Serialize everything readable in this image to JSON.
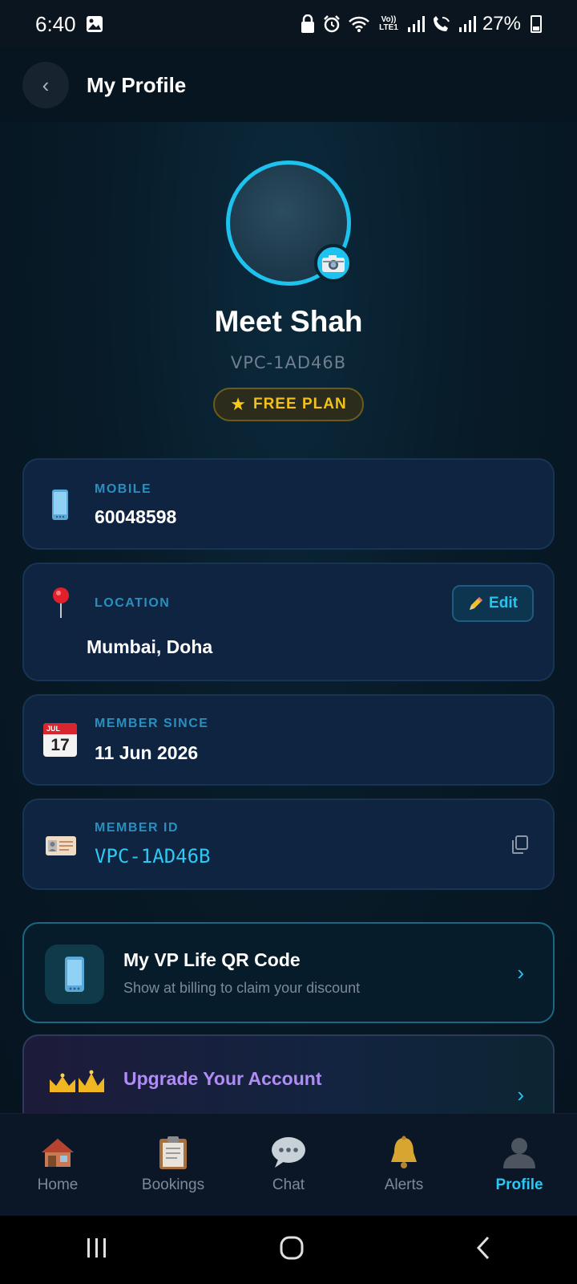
{
  "status_bar": {
    "time": "6:40",
    "battery": "27%",
    "network_label": "Vo)) LTE1"
  },
  "header": {
    "title": "My Profile",
    "back_glyph": "‹"
  },
  "profile": {
    "name": "Meet Shah",
    "id": "VPC-1AD46B",
    "plan": "FREE PLAN"
  },
  "cards": {
    "mobile": {
      "label": "MOBILE",
      "value": "60048598"
    },
    "location": {
      "label": "LOCATION",
      "value": "Mumbai, Doha",
      "edit_label": "Edit"
    },
    "member_since": {
      "label": "MEMBER SINCE",
      "value": "11 Jun 2026",
      "calendar_month": "JUL",
      "calendar_day": "17"
    },
    "member_id": {
      "label": "MEMBER ID",
      "value": "VPC-1AD46B"
    }
  },
  "qr_card": {
    "title": "My VP Life QR Code",
    "subtitle": "Show at billing to claim your discount"
  },
  "upgrade_card": {
    "title": "Upgrade Your Account"
  },
  "bottom_nav": {
    "items": [
      {
        "label": "Home",
        "icon": "home-icon"
      },
      {
        "label": "Bookings",
        "icon": "clipboard-icon"
      },
      {
        "label": "Chat",
        "icon": "chat-bubble-icon"
      },
      {
        "label": "Alerts",
        "icon": "bell-icon"
      },
      {
        "label": "Profile",
        "icon": "profile-silhouette-icon"
      }
    ],
    "active": "Profile"
  },
  "colors": {
    "accent": "#1ec2ee",
    "label_blue": "#2a8fbf",
    "plan_gold": "#f1c21d",
    "upgrade_purple": "#b28cf5",
    "card_bg": "#0e2440",
    "page_bg": "#06121c"
  }
}
